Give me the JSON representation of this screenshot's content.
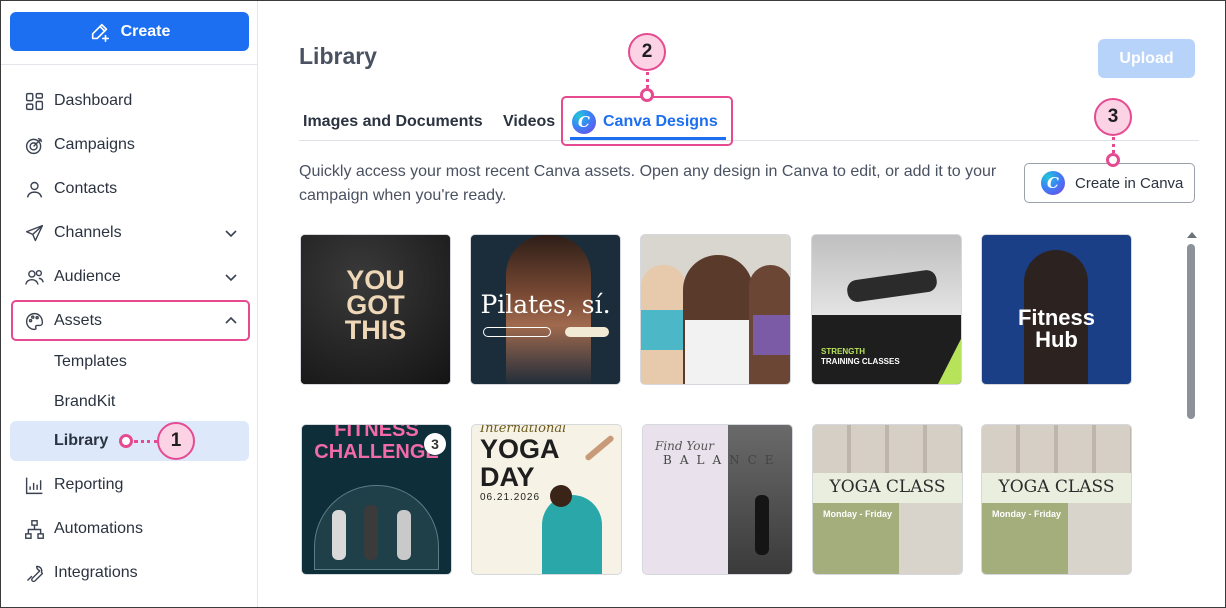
{
  "sidebar": {
    "create_label": "Create",
    "items": [
      {
        "label": "Dashboard",
        "icon": "dashboard-icon"
      },
      {
        "label": "Campaigns",
        "icon": "target-icon"
      },
      {
        "label": "Contacts",
        "icon": "person-icon"
      },
      {
        "label": "Channels",
        "icon": "paper-plane-icon"
      },
      {
        "label": "Audience",
        "icon": "people-icon"
      },
      {
        "label": "Assets",
        "icon": "palette-icon"
      },
      {
        "label": "Reporting",
        "icon": "chart-icon"
      },
      {
        "label": "Automations",
        "icon": "flow-icon"
      },
      {
        "label": "Integrations",
        "icon": "wrench-icon"
      }
    ],
    "sub_items": [
      {
        "label": "Templates"
      },
      {
        "label": "BrandKit"
      },
      {
        "label": "Library"
      }
    ]
  },
  "callouts": [
    "1",
    "2",
    "3"
  ],
  "main": {
    "title": "Library",
    "upload_label": "Upload",
    "tabs": [
      {
        "label": "Images and Documents"
      },
      {
        "label": "Videos"
      },
      {
        "label": "Canva Designs"
      }
    ],
    "description": "Quickly access your most recent Canva assets. Open any design in Canva to edit, or add it to your campaign when you're ready.",
    "create_in_canva_label": "Create in Canva",
    "canva_logo_letter": "C"
  },
  "designs": [
    {
      "name": "you-got-this",
      "text": [
        "YOU",
        "GOT",
        "THIS"
      ]
    },
    {
      "name": "pilates",
      "text": [
        "Pilates, sí."
      ]
    },
    {
      "name": "friends-photo",
      "text": []
    },
    {
      "name": "strength-training",
      "text": [
        "STRENGTH",
        "TRAINING CLASSES"
      ]
    },
    {
      "name": "fitness-hub",
      "text": [
        "Fitness",
        "Hub"
      ]
    },
    {
      "name": "fitness-challenge",
      "text": [
        "FITNESS",
        "CHALLENGE"
      ],
      "badge": "3"
    },
    {
      "name": "yoga-day",
      "text": [
        "International",
        "YOGA",
        "DAY",
        "06.21.2026"
      ]
    },
    {
      "name": "find-your-balance",
      "text": [
        "Find Your",
        "BALANCE"
      ]
    },
    {
      "name": "yoga-class-1",
      "text": [
        "YOGA CLASS",
        "Monday - Friday"
      ]
    },
    {
      "name": "yoga-class-2",
      "text": [
        "YOGA CLASS",
        "Monday - Friday"
      ]
    }
  ]
}
